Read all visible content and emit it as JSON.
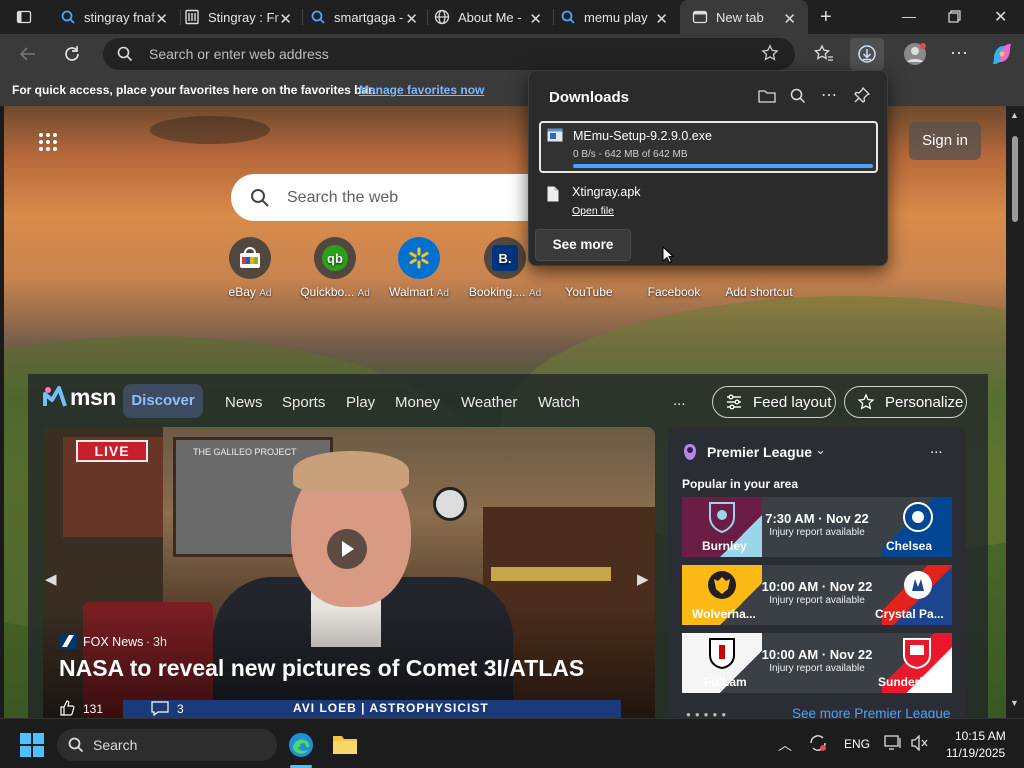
{
  "tabs": [
    {
      "title": "stingray fnaf",
      "icon": "search-icon"
    },
    {
      "title": "Stingray : Fr",
      "icon": "document-icon"
    },
    {
      "title": "smartgaga -",
      "icon": "search-icon"
    },
    {
      "title": "About Me -",
      "icon": "globe-icon"
    },
    {
      "title": "memu play",
      "icon": "search-icon"
    },
    {
      "title": "New tab",
      "icon": "new-tab-icon",
      "active": true
    }
  ],
  "address": {
    "placeholder": "Search or enter web address"
  },
  "favorites_bar": {
    "text": "For quick access, place your favorites here on the favorites bar.",
    "link": "Manage favorites now"
  },
  "newtab": {
    "search_placeholder": "Search the web",
    "sign_in": "Sign in",
    "quick_links": [
      {
        "label": "eBay",
        "ad": "Ad"
      },
      {
        "label": "Quickbo...",
        "ad": "Ad"
      },
      {
        "label": "Walmart",
        "ad": "Ad"
      },
      {
        "label": "Booking....",
        "ad": "Ad"
      },
      {
        "label": "YouTube",
        "ad": ""
      },
      {
        "label": "Facebook",
        "ad": ""
      },
      {
        "label": "Add shortcut",
        "ad": ""
      }
    ]
  },
  "msn": {
    "logo": "msn",
    "nav": [
      "Discover",
      "News",
      "Sports",
      "Play",
      "Money",
      "Weather",
      "Watch"
    ],
    "more": "...",
    "feed_layout": "Feed layout",
    "personalize": "Personalize",
    "hero": {
      "live": "LIVE",
      "source": "FOX News",
      "age": "3h",
      "headline": "NASA to reveal new pictures of Comet 3I/ATLAS",
      "likes": "131",
      "comments": "3",
      "chyron": "AVI LOEB | ASTROPHYSICIST",
      "poster": "THE GALILEO PROJECT"
    },
    "premier_league": {
      "title": "Premier League",
      "subtitle": "Popular in your area",
      "more": "...",
      "see_more": "See more Premier League",
      "matches": [
        {
          "home": "Burnley",
          "away": "Chelsea",
          "time": "7:30 AM · Nov 22",
          "note": "Injury report available"
        },
        {
          "home": "Wolverha...",
          "away": "Crystal Pa...",
          "time": "10:00 AM · Nov 22",
          "note": "Injury report available"
        },
        {
          "home": "Fulham",
          "away": "Sunderland",
          "time": "10:00 AM · Nov 22",
          "note": "Injury report available"
        }
      ]
    }
  },
  "downloads": {
    "title": "Downloads",
    "items": [
      {
        "name": "MEmu-Setup-9.2.9.0.exe",
        "status": "0 B/s - 642 MB of 642 MB",
        "progress": 1.0
      },
      {
        "name": "Xtingray.apk",
        "action": "Open file"
      }
    ],
    "see_more": "See more"
  },
  "taskbar": {
    "search": "Search",
    "lang": "ENG",
    "time": "10:15 AM",
    "date": "11/19/2025"
  },
  "colors": {
    "accent": "#4aa3ff",
    "link": "#7eb6ff",
    "discover": "#8fbfff"
  }
}
